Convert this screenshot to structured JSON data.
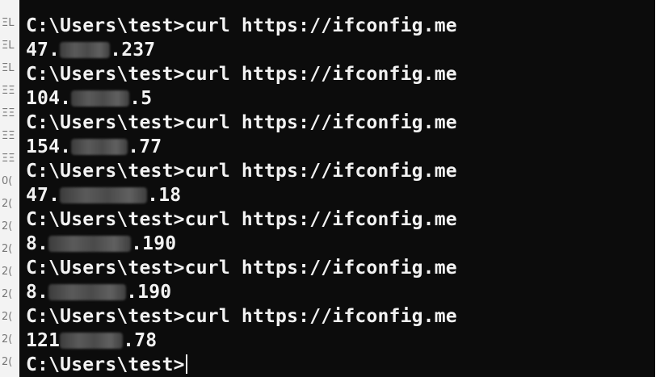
{
  "background_window": {
    "fragments": [
      "ΞL",
      "ΞL",
      "ΞL",
      "ΞΞ",
      "ΞΞ",
      "ΞΞ",
      "ΞΞ",
      "0(",
      "2(",
      "2(",
      "2(",
      "2(",
      "2(",
      "2(",
      "2(",
      "2("
    ]
  },
  "terminal": {
    "prompt": "C:\\Users\\test>",
    "lines": [
      {
        "type": "command",
        "prompt": "C:\\Users\\test>",
        "command": "curl https://ifconfig.me"
      },
      {
        "type": "output",
        "prefix": "47.",
        "suffix": ".237"
      },
      {
        "type": "command",
        "prompt": "C:\\Users\\test>",
        "command": "curl https://ifconfig.me"
      },
      {
        "type": "output",
        "prefix": "104.",
        "suffix": ".5"
      },
      {
        "type": "command",
        "prompt": "C:\\Users\\test>",
        "command": "curl https://ifconfig.me"
      },
      {
        "type": "output",
        "prefix": "154.",
        "suffix": ".77"
      },
      {
        "type": "command",
        "prompt": "C:\\Users\\test>",
        "command": "curl https://ifconfig.me"
      },
      {
        "type": "output",
        "prefix": "47.",
        "suffix": ".18"
      },
      {
        "type": "command",
        "prompt": "C:\\Users\\test>",
        "command": "curl https://ifconfig.me"
      },
      {
        "type": "output",
        "prefix": "8.",
        "suffix": ".190"
      },
      {
        "type": "command",
        "prompt": "C:\\Users\\test>",
        "command": "curl https://ifconfig.me"
      },
      {
        "type": "output",
        "prefix": "8.",
        "suffix": ".190"
      },
      {
        "type": "command",
        "prompt": "C:\\Users\\test>",
        "command": "curl https://ifconfig.me"
      },
      {
        "type": "output",
        "prefix": "121",
        "suffix": ".78"
      }
    ],
    "current_prompt": "C:\\Users\\test>"
  },
  "colors": {
    "terminal_bg": "#0c0c0c",
    "terminal_fg": "#f2f2f2",
    "redaction": "#4a4a4a"
  }
}
